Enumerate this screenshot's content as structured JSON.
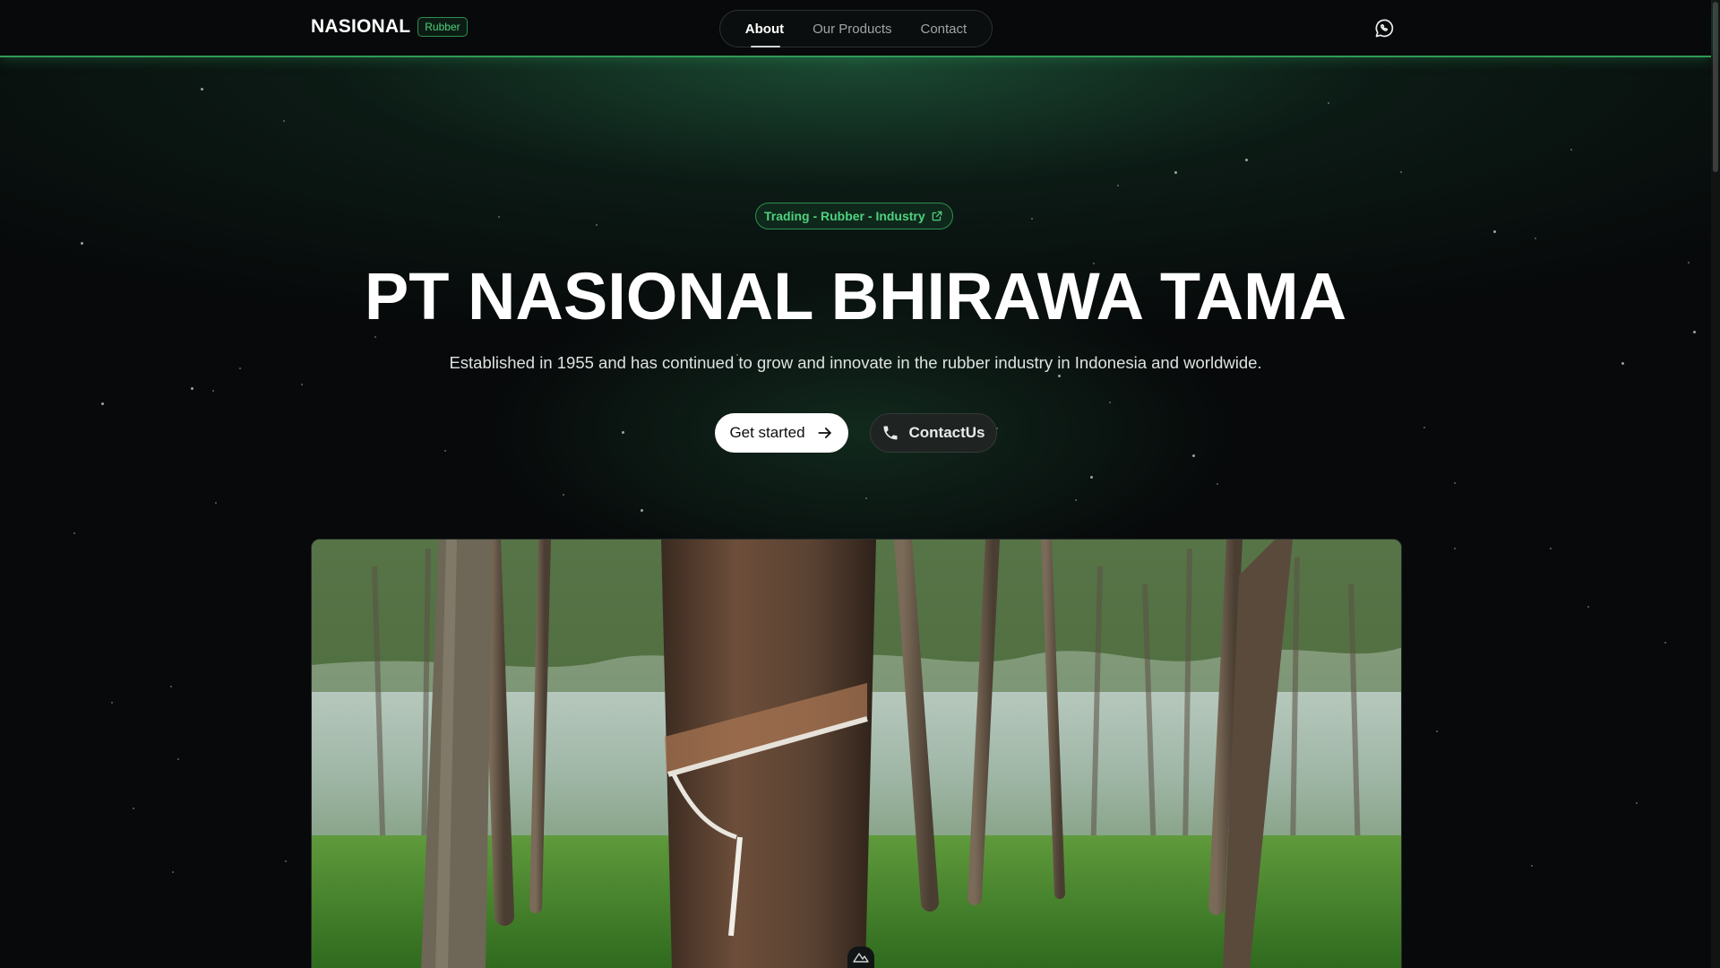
{
  "brand": {
    "name": "NASIONAL",
    "badge": "Rubber"
  },
  "nav": {
    "items": [
      {
        "label": "About",
        "active": true
      },
      {
        "label": "Our Products",
        "active": false
      },
      {
        "label": "Contact",
        "active": false
      }
    ]
  },
  "header_icons": {
    "whatsapp": "whatsapp-icon"
  },
  "hero": {
    "tag": "Trading - Rubber - Industry",
    "tag_icon": "external-link-icon",
    "title": "PT NASIONAL BHIRAWA TAMA",
    "subtitle": "Established in 1955 and has continued to grow and innovate in the rubber industry in Indonesia and worldwide.",
    "primary_button": {
      "label": "Get started",
      "icon": "arrow-right-icon"
    },
    "secondary_button": {
      "label": "ContactUs",
      "icon": "phone-icon"
    }
  },
  "hero_image": {
    "subject": "rubber-plantation-photo"
  },
  "colors": {
    "accent_green": "#4fd17e",
    "background": "#07090a",
    "nav_border": "#2f9a58"
  }
}
